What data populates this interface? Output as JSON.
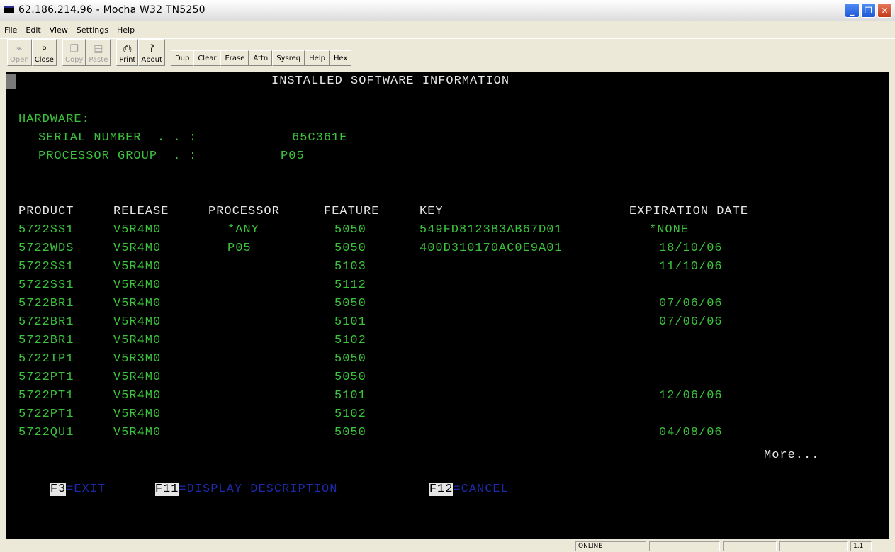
{
  "window": {
    "title": "62.186.214.96 - Mocha W32 TN5250",
    "controls": [
      "minimize",
      "maximize",
      "close"
    ]
  },
  "menu": [
    "File",
    "Edit",
    "View",
    "Settings",
    "Help"
  ],
  "toolbar": {
    "icon_buttons": [
      {
        "label": "Open",
        "icon": "open-icon",
        "enabled": false
      },
      {
        "label": "Close",
        "icon": "close-session-icon",
        "enabled": true
      },
      {
        "label": "Copy",
        "icon": "copy-icon",
        "enabled": false
      },
      {
        "label": "Paste",
        "icon": "paste-icon",
        "enabled": false
      },
      {
        "label": "Print",
        "icon": "printer-icon",
        "enabled": true
      },
      {
        "label": "About",
        "icon": "question-icon",
        "enabled": true
      }
    ],
    "text_buttons": [
      "Dup",
      "Clear",
      "Erase",
      "Attn",
      "Sysreq",
      "Help",
      "Hex"
    ]
  },
  "screen": {
    "title": "INSTALLED SOFTWARE INFORMATION",
    "hardware_label": "HARDWARE:",
    "serial_label": "SERIAL NUMBER  . . :",
    "serial_value": "65C361E",
    "group_label": "PROCESSOR GROUP  . :",
    "group_value": "P05",
    "headers": {
      "product": "PRODUCT",
      "release": "RELEASE",
      "processor": "PROCESSOR",
      "feature": "FEATURE",
      "key": "KEY",
      "expiration": "EXPIRATION DATE"
    },
    "rows": [
      {
        "product": "5722SS1",
        "release": "V5R4M0",
        "processor": "*ANY",
        "feature": "5050",
        "key": "549FD8123B3AB67D01",
        "expiration": "*NONE"
      },
      {
        "product": "5722WDS",
        "release": "V5R4M0",
        "processor": "P05",
        "feature": "5050",
        "key": "400D310170AC0E9A01",
        "expiration": "18/10/06"
      },
      {
        "product": "5722SS1",
        "release": "V5R4M0",
        "processor": "",
        "feature": "5103",
        "key": "",
        "expiration": "11/10/06"
      },
      {
        "product": "5722SS1",
        "release": "V5R4M0",
        "processor": "",
        "feature": "5112",
        "key": "",
        "expiration": ""
      },
      {
        "product": "5722BR1",
        "release": "V5R4M0",
        "processor": "",
        "feature": "5050",
        "key": "",
        "expiration": "07/06/06"
      },
      {
        "product": "5722BR1",
        "release": "V5R4M0",
        "processor": "",
        "feature": "5101",
        "key": "",
        "expiration": "07/06/06"
      },
      {
        "product": "5722BR1",
        "release": "V5R4M0",
        "processor": "",
        "feature": "5102",
        "key": "",
        "expiration": ""
      },
      {
        "product": "5722IP1",
        "release": "V5R3M0",
        "processor": "",
        "feature": "5050",
        "key": "",
        "expiration": ""
      },
      {
        "product": "5722PT1",
        "release": "V5R4M0",
        "processor": "",
        "feature": "5050",
        "key": "",
        "expiration": ""
      },
      {
        "product": "5722PT1",
        "release": "V5R4M0",
        "processor": "",
        "feature": "5101",
        "key": "",
        "expiration": "12/06/06"
      },
      {
        "product": "5722PT1",
        "release": "V5R4M0",
        "processor": "",
        "feature": "5102",
        "key": "",
        "expiration": ""
      },
      {
        "product": "5722QU1",
        "release": "V5R4M0",
        "processor": "",
        "feature": "5050",
        "key": "",
        "expiration": "04/08/06"
      }
    ],
    "more": "More...",
    "fkeys": [
      {
        "key": "F3",
        "action": "=EXIT"
      },
      {
        "key": "F11",
        "action": "=DISPLAY DESCRIPTION"
      },
      {
        "key": "F12",
        "action": "=CANCEL"
      }
    ]
  },
  "status": {
    "state": "ONLINE",
    "position": "1,1"
  },
  "colors": {
    "screen_bg": "#000000",
    "field_text": "#3cc23c",
    "label_text": "#e6e6e6",
    "fkey_text": "#1d2aa8"
  }
}
